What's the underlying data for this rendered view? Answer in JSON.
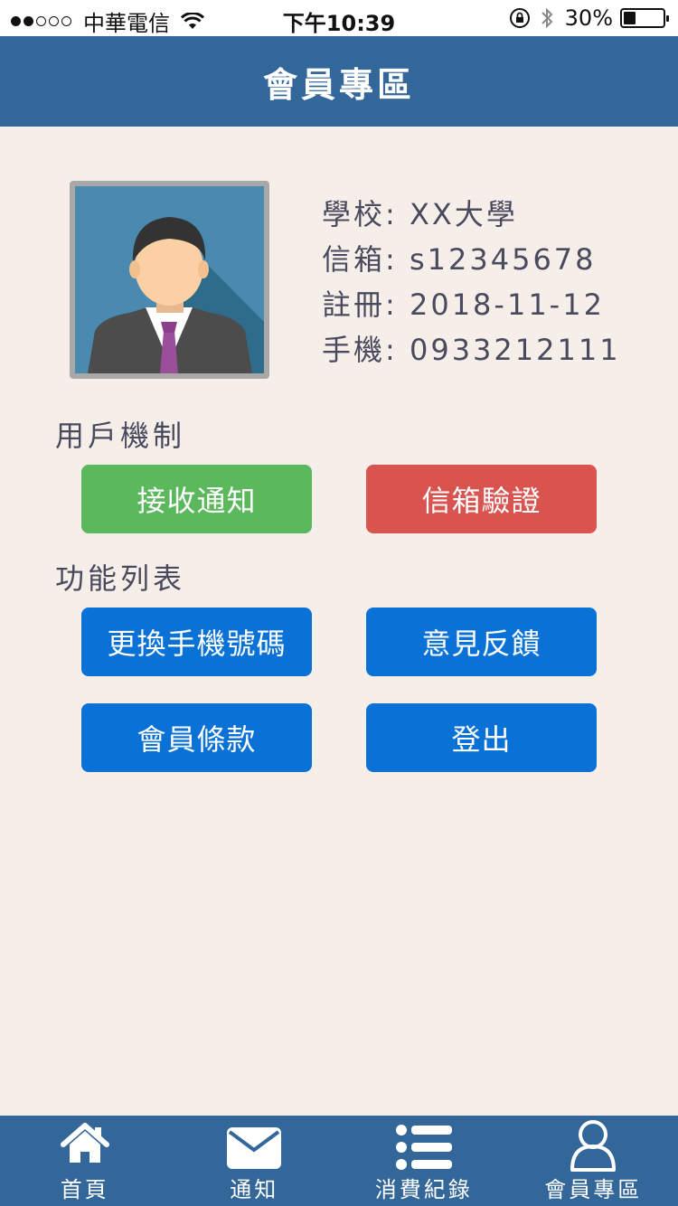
{
  "status_bar": {
    "signal_dots_filled": 2,
    "signal_dots_total": 5,
    "carrier": "中華電信",
    "time": "下午10:39",
    "battery": "30%",
    "battery_level": 0.3
  },
  "header": {
    "title": "會員專區"
  },
  "profile": {
    "school_label": "學校:",
    "school": "XX大學",
    "email_label": "信箱:",
    "email": "s12345678",
    "register_label": "註冊:",
    "register": "2018-11-12",
    "phone_label": "手機:",
    "phone": "0933212111"
  },
  "user_section": {
    "title": "用戶機制",
    "receive_notifications": "接收通知",
    "email_verification": "信箱驗證"
  },
  "function_section": {
    "title": "功能列表",
    "change_phone": "更換手機號碼",
    "feedback": "意見反饋",
    "member_terms": "會員條款",
    "logout": "登出"
  },
  "tab_bar": {
    "items": [
      {
        "label": "首頁",
        "icon": "home-icon"
      },
      {
        "label": "通知",
        "icon": "envelope-icon"
      },
      {
        "label": "消費紀錄",
        "icon": "list-icon"
      },
      {
        "label": "會員專區",
        "icon": "user-icon"
      }
    ]
  },
  "colors": {
    "brand": "#336699",
    "background": "#f6eee9",
    "green_button": "#5cb85c",
    "red_button": "#d9534f",
    "blue_button": "#0a72d6"
  }
}
